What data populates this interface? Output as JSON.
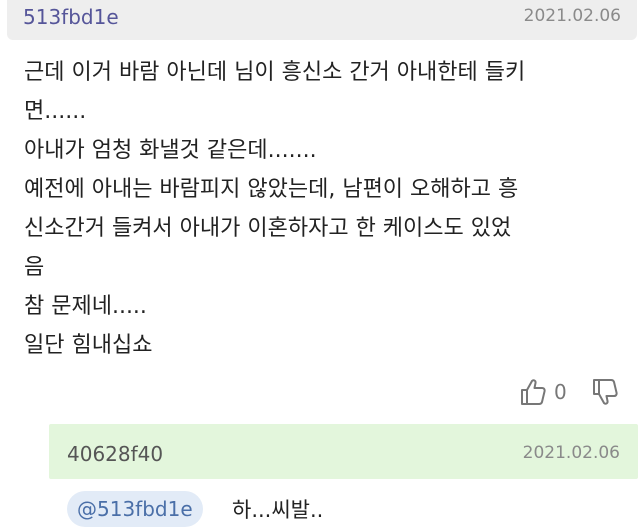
{
  "comment": {
    "author": "513fbd1e",
    "date": "2021.02.06",
    "lines": [
      "근데 이거 바람 아닌데 님이 흥신소 간거 아내한테 들키",
      "면......",
      "아내가 엄청 화낼것 같은데.......",
      "예전에 아내는 바람피지 않았는데, 남편이 오해하고 흥",
      "신소간거 들켜서 아내가 이혼하자고 한 케이스도 있었",
      "음",
      "참 문제네.....",
      "일단 힘내십쇼"
    ],
    "likes": "0",
    "icons": {
      "like": "thumbs-up-icon",
      "dislike": "thumbs-down-icon"
    }
  },
  "reply": {
    "author": "40628f40",
    "date": "2021.02.06",
    "mention": "@513fbd1e",
    "text": "하...씨발.."
  },
  "colors": {
    "comment_header_bg": "#eeeeee",
    "reply_header_bg": "#e3f6dc",
    "mention_bg": "#e2ebf7",
    "mention_text": "#4a6fa8"
  }
}
